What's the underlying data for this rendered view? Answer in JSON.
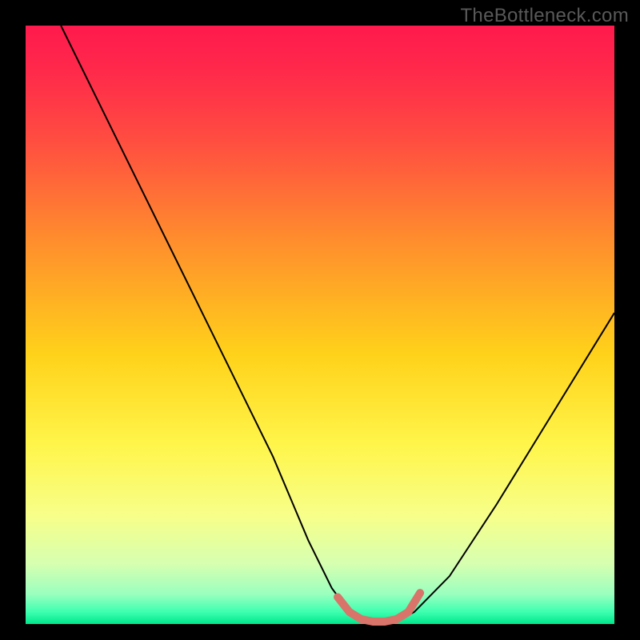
{
  "watermark": "TheBottleneck.com",
  "chart_data": {
    "type": "line",
    "title": "",
    "xlabel": "",
    "ylabel": "",
    "xlim": [
      0,
      100
    ],
    "ylim": [
      0,
      100
    ],
    "grid": false,
    "legend": false,
    "background": {
      "stops": [
        {
          "pct": 0.0,
          "color": "#ff1a4d"
        },
        {
          "pct": 0.08,
          "color": "#ff2a4a"
        },
        {
          "pct": 0.2,
          "color": "#ff5040"
        },
        {
          "pct": 0.35,
          "color": "#ff8a2e"
        },
        {
          "pct": 0.55,
          "color": "#ffd21a"
        },
        {
          "pct": 0.7,
          "color": "#fff54a"
        },
        {
          "pct": 0.82,
          "color": "#f7ff8a"
        },
        {
          "pct": 0.9,
          "color": "#d6ffb0"
        },
        {
          "pct": 0.95,
          "color": "#9affbf"
        },
        {
          "pct": 0.98,
          "color": "#3dffb0"
        },
        {
          "pct": 1.0,
          "color": "#00e78a"
        }
      ]
    },
    "series": [
      {
        "name": "bottleneck-curve",
        "type": "line",
        "color": "#000000",
        "width": 2,
        "x": [
          6,
          12,
          18,
          24,
          30,
          36,
          42,
          48,
          52,
          55,
          58,
          62,
          66,
          72,
          80,
          90,
          100
        ],
        "y": [
          100,
          88,
          76,
          64,
          52,
          40,
          28,
          14,
          6,
          2,
          0,
          0,
          2,
          8,
          20,
          36,
          52
        ]
      },
      {
        "name": "trough-marker",
        "type": "line",
        "color": "#d9746a",
        "width": 10,
        "x": [
          53,
          55,
          57,
          59,
          61,
          63,
          65,
          67
        ],
        "y": [
          4.5,
          2.0,
          0.8,
          0.4,
          0.4,
          0.8,
          2.0,
          5.2
        ]
      }
    ]
  }
}
